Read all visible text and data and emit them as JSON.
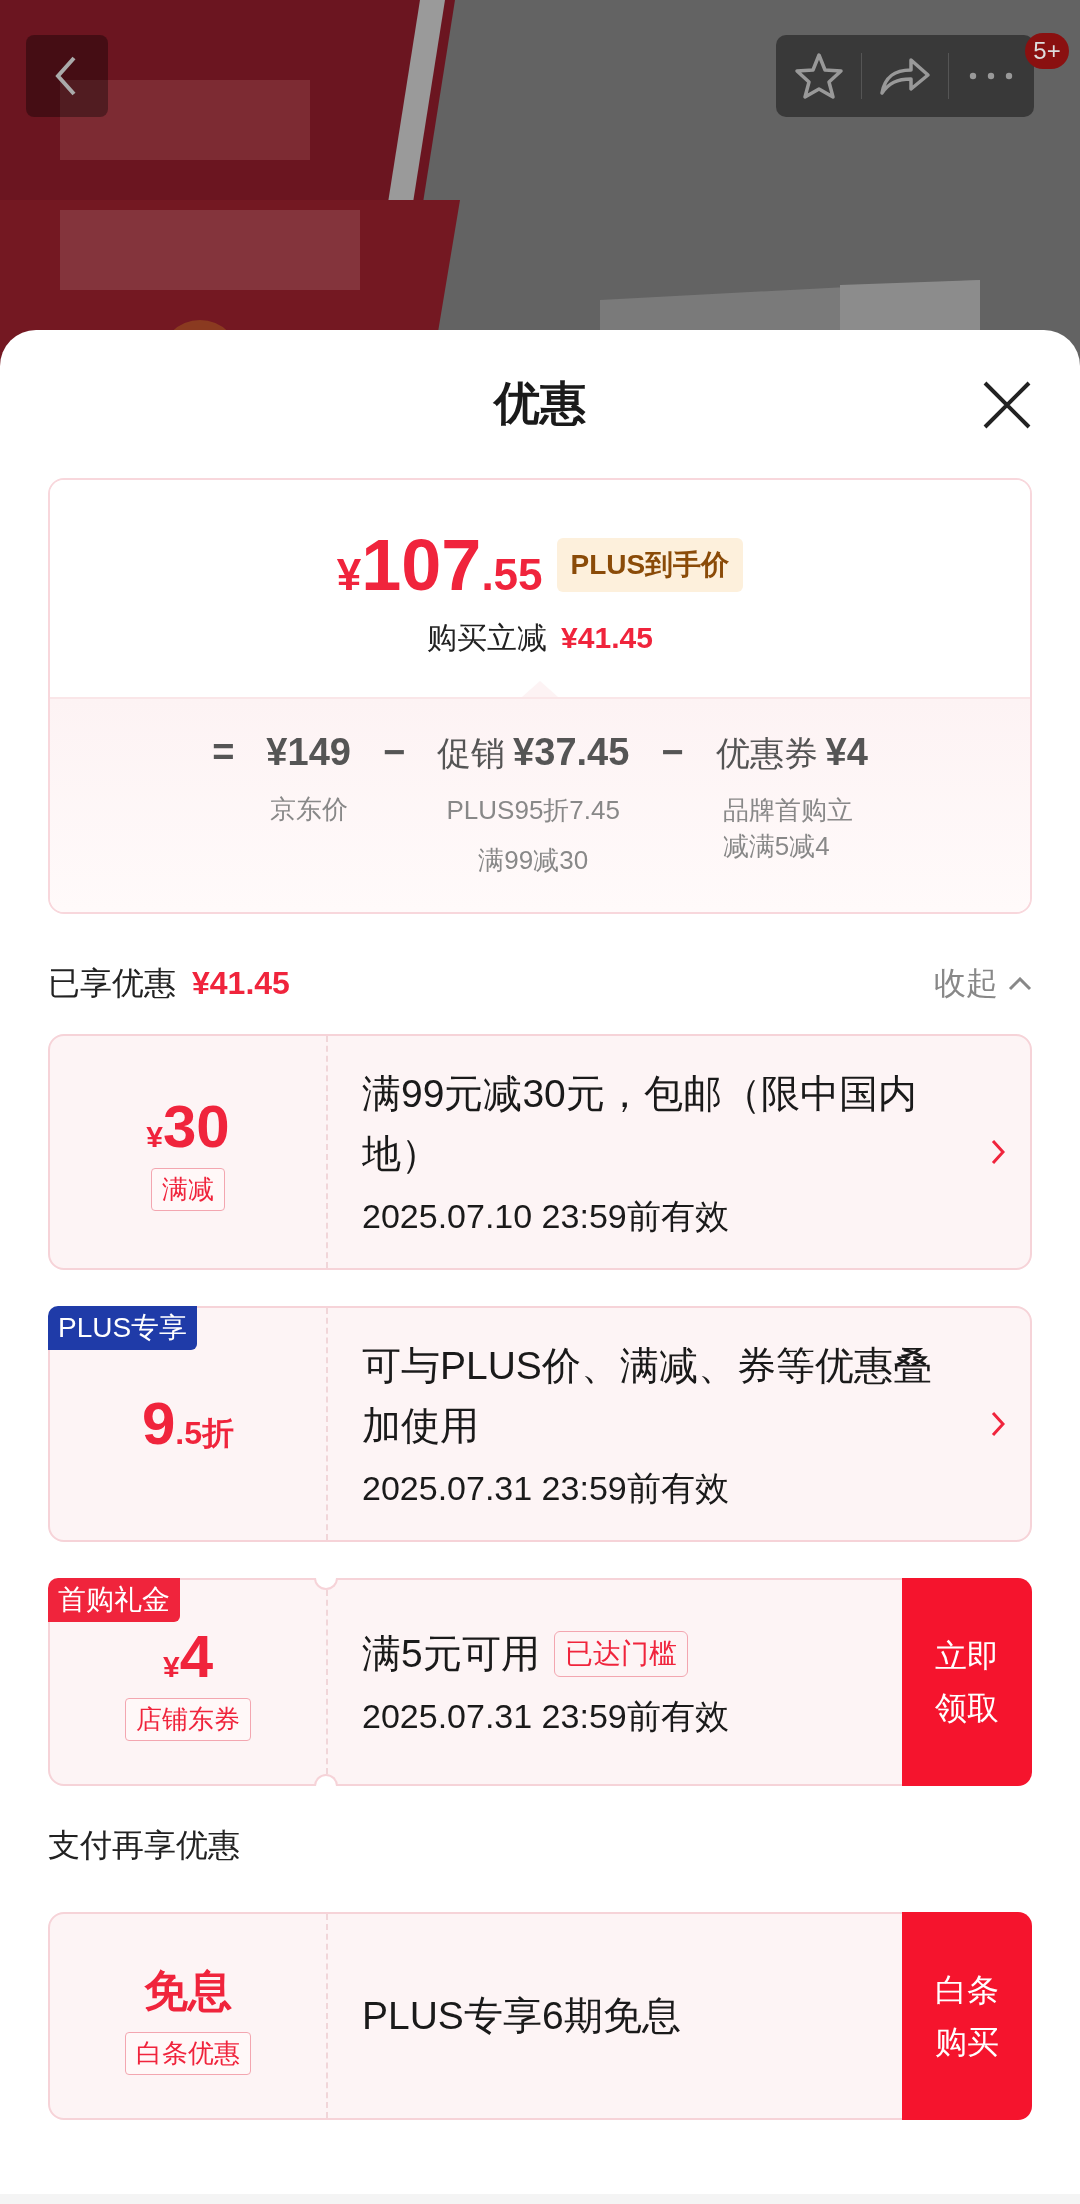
{
  "top_bar": {
    "badge": "5+"
  },
  "sheet_title": "优惠",
  "price_card": {
    "currency": "¥",
    "price_main": "107",
    "price_decimal": ".55",
    "tag": "PLUS到手价",
    "saving_label": "购买立减",
    "saving": "¥41.45",
    "breakdown": [
      {
        "op": "=",
        "amount": "¥149",
        "notes": [
          "京东价"
        ]
      },
      {
        "op": "−",
        "label": "促销",
        "amount": "¥37.45",
        "notes": [
          "PLUS95折7.45",
          "满99减30"
        ]
      },
      {
        "op": "−",
        "label": "优惠券",
        "amount": "¥4",
        "notes": [
          "品牌首购立减满5减4"
        ]
      }
    ]
  },
  "applied": {
    "label": "已享优惠",
    "amount": "¥41.45",
    "toggle": "收起",
    "expanded": true,
    "coupons": [
      {
        "kind": "arrow",
        "value": {
          "prefix": "¥",
          "main": "30"
        },
        "tag": "满减",
        "title": "满99元减30元，包邮（限中国内地）",
        "validity": "2025.07.10 23:59前有效",
        "notched": false
      },
      {
        "kind": "arrow",
        "ribbon": {
          "text": "PLUS专享",
          "color": "#1f3ba8"
        },
        "value": {
          "main": "9",
          "suffix": ".5折"
        },
        "title": "可与PLUS价、满减、券等优惠叠加使用",
        "validity": "2025.07.31 23:59前有效",
        "notched": false
      },
      {
        "kind": "button",
        "ribbon": {
          "text": "首购礼金",
          "color": "#f0243c"
        },
        "value": {
          "prefix": "¥",
          "main": "4"
        },
        "tag": "店铺东券",
        "title": "满5元可用",
        "badge": "已达门槛",
        "validity": "2025.07.31 23:59前有效",
        "button": "立即领取",
        "notched": true
      }
    ]
  },
  "payment": {
    "label": "支付再享优惠",
    "coupons": [
      {
        "kind": "button",
        "value": {
          "main": "免息"
        },
        "tag": "白条优惠",
        "title": "PLUS专享6期免息",
        "button": "白条购买",
        "notched": false
      }
    ]
  }
}
